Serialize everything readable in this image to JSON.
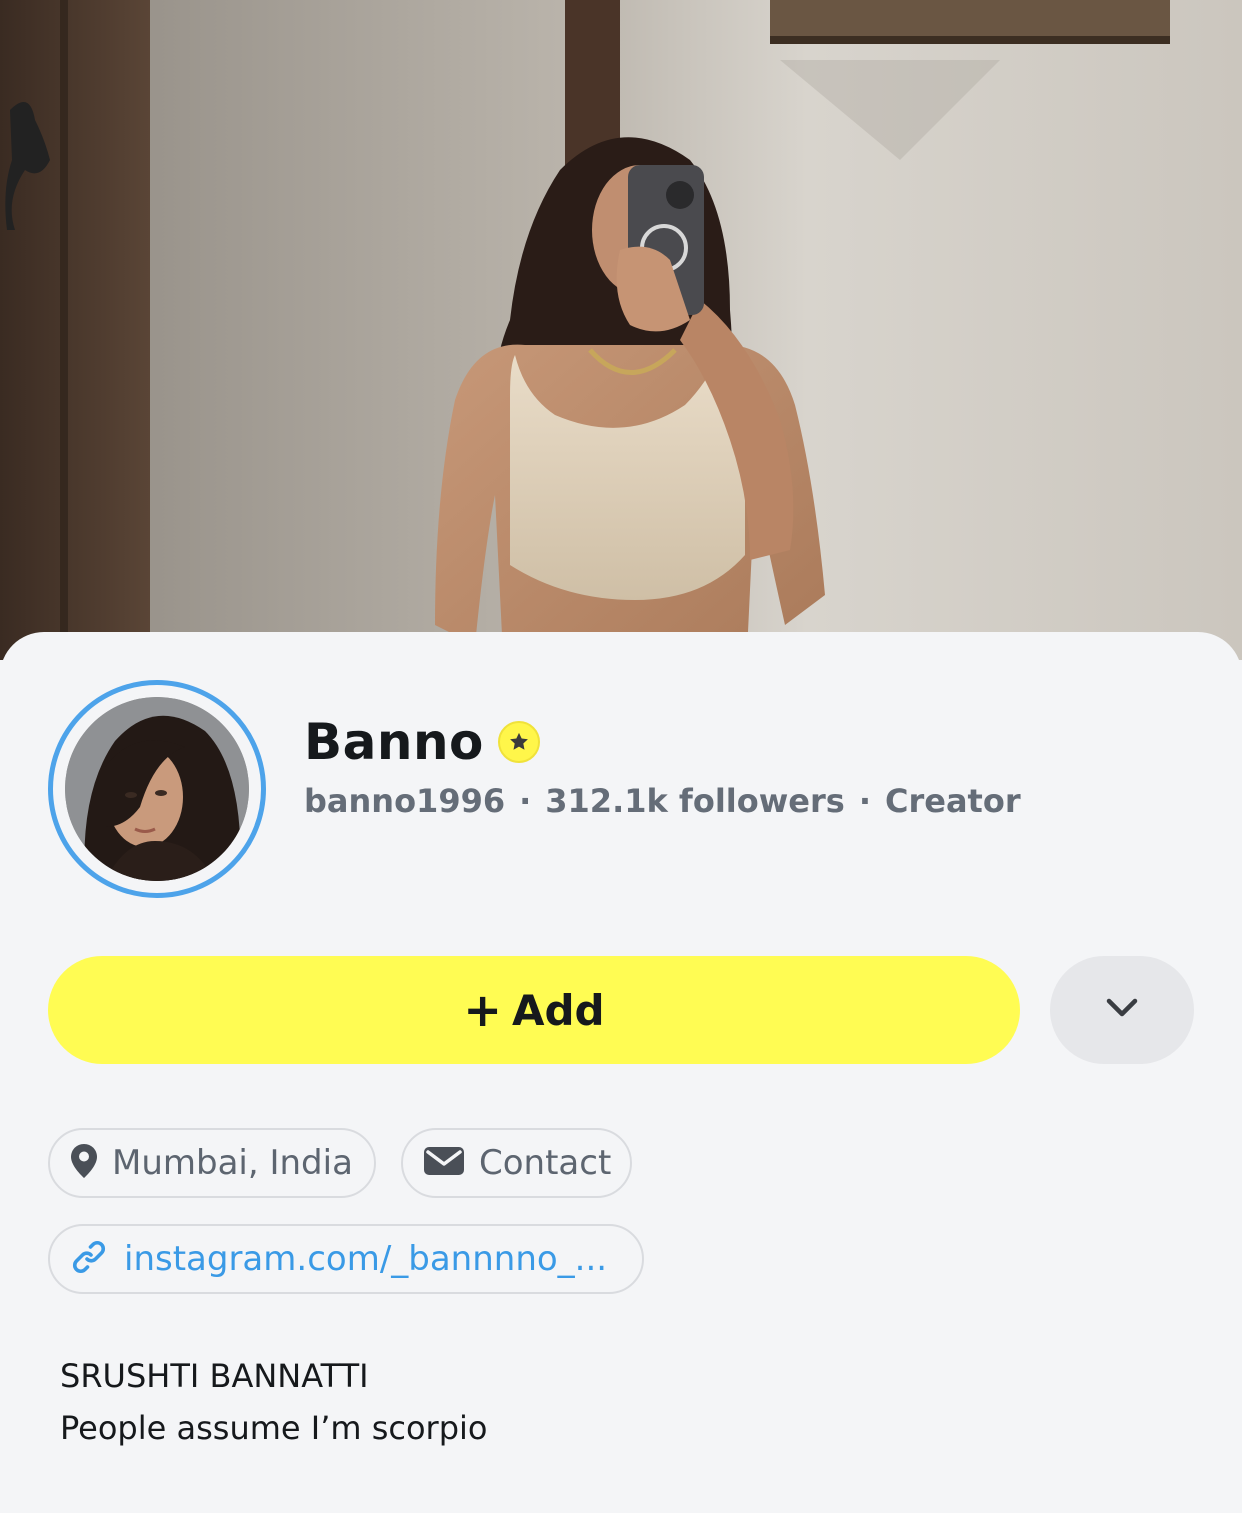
{
  "profile": {
    "display_name": "Banno",
    "username": "banno1996",
    "followers": "312.1k followers",
    "category": "Creator",
    "meta_separator": "·"
  },
  "actions": {
    "add_plus": "+",
    "add_label": "Add",
    "more_icon": "chevron-down-icon"
  },
  "chips": {
    "location": "Mumbai, India",
    "contact": "Contact",
    "link": "instagram.com/_bannnno_..."
  },
  "bio": {
    "line1": "SRUSHTI BANNATTI",
    "line2": "People assume I’m scorpio"
  },
  "colors": {
    "add_button": "#fffc53",
    "avatar_ring": "#4da3ea",
    "link": "#3a9ae6",
    "badge": "#fff64a",
    "sheet_bg": "#f4f5f7"
  }
}
